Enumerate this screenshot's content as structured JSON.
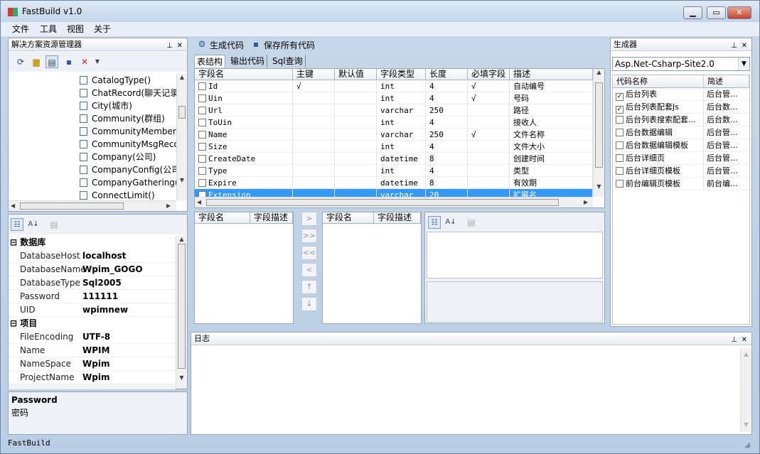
{
  "app": {
    "title": "FastBuild v1.0",
    "status": "FastBuild"
  },
  "menu": [
    "文件",
    "工具",
    "视图",
    "关于"
  ],
  "solution": {
    "title": "解决方案资源管理器",
    "items": [
      "CatalogType()",
      "ChatRecord(聊天记录",
      "City(城市)",
      "Community(群组)",
      "CommunityMember",
      "CommunityMsgReco",
      "Company(公司)",
      "CompanyConfig(公司",
      "CompanyGathering(",
      "ConnectLimit()"
    ]
  },
  "properties": {
    "categories": [
      {
        "name": "数据库",
        "rows": [
          [
            "DatabaseHost",
            "localhost"
          ],
          [
            "DatabaseName",
            "Wpim_GOGO"
          ],
          [
            "DatabaseType",
            "Sql2005"
          ],
          [
            "Password",
            "111111"
          ],
          [
            "UID",
            "wpimnew"
          ]
        ]
      },
      {
        "name": "项目",
        "rows": [
          [
            "FileEncoding",
            "UTF-8"
          ],
          [
            "Name",
            "WPIM"
          ],
          [
            "NameSpace",
            "Wpim"
          ],
          [
            "ProjectName",
            "Wpim"
          ]
        ]
      }
    ],
    "desc_title": "Password",
    "desc_text": "密码"
  },
  "toolbar": {
    "gen_code": "生成代码",
    "save_all": "保存所有代码"
  },
  "tabs": [
    "表结构",
    "输出代码",
    "Sql查询"
  ],
  "fields": {
    "headers": [
      "字段名",
      "主键",
      "默认值",
      "字段类型",
      "长度",
      "必填字段",
      "描述"
    ],
    "rows": [
      [
        "Id",
        "√",
        "",
        "int",
        "4",
        "√",
        "自动编号"
      ],
      [
        "Uin",
        "",
        "",
        "int",
        "4",
        "√",
        "号码"
      ],
      [
        "Url",
        "",
        "",
        "varchar",
        "250",
        "",
        "路径"
      ],
      [
        "ToUin",
        "",
        "",
        "int",
        "4",
        "",
        "接收人"
      ],
      [
        "Name",
        "",
        "",
        "varchar",
        "250",
        "√",
        "文件名称"
      ],
      [
        "Size",
        "",
        "",
        "int",
        "4",
        "",
        "文件大小"
      ],
      [
        "CreateDate",
        "",
        "",
        "datetime",
        "8",
        "",
        "创建时间"
      ],
      [
        "Type",
        "",
        "",
        "int",
        "4",
        "",
        "类型"
      ],
      [
        "Expire",
        "",
        "",
        "datetime",
        "8",
        "",
        "有效期"
      ],
      [
        "Extension",
        "",
        "",
        "varchar",
        "20",
        "",
        "扩展名"
      ]
    ]
  },
  "mapping": {
    "left_headers": [
      "字段名",
      "字段描述"
    ],
    "right_headers": [
      "字段名",
      "字段描述"
    ],
    "buttons": [
      ">",
      ">>",
      "<<",
      "<",
      "↑",
      "↓"
    ]
  },
  "generator": {
    "title": "生成器",
    "selected": "Asp.Net-Csharp-Site2.0",
    "headers": [
      "代码名称",
      "简述"
    ],
    "rows": [
      [
        "后台列表",
        "后台管...",
        true
      ],
      [
        "后台列表配套Js",
        "后台数...",
        true
      ],
      [
        "后台列表搜索配套...",
        "后台数...",
        false
      ],
      [
        "后台数据编辑",
        "后台管...",
        false
      ],
      [
        "后台数据编辑模板",
        "后台管...",
        false
      ],
      [
        "后台详细页",
        "后台管...",
        false
      ],
      [
        "后台详细页模板",
        "后台管...",
        false
      ],
      [
        "前台编辑页模板",
        "前台编...",
        false
      ]
    ]
  },
  "log": {
    "title": "日志"
  }
}
